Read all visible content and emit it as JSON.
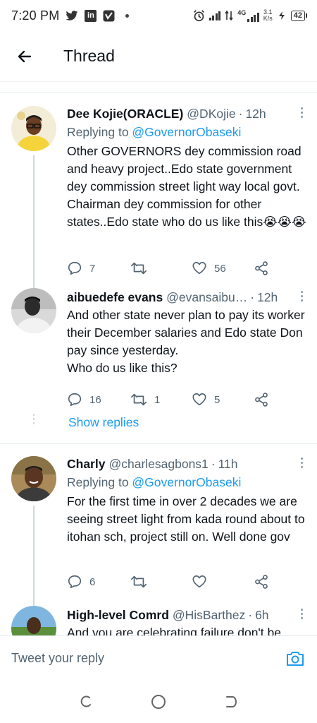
{
  "status_bar": {
    "time": "7:20 PM",
    "apps": [
      "twitter-icon",
      "linkedin-icon",
      "vimeo-icon"
    ],
    "network": "4G",
    "speed_value": "3.1",
    "speed_unit": "K/s",
    "battery": "42"
  },
  "header": {
    "title": "Thread"
  },
  "tweets": [
    {
      "name": "Dee Kojie(ORACLE)",
      "handle": "@DKojie",
      "time": "12h",
      "replying_prefix": "Replying to ",
      "replying_to": "@GovernorObaseki",
      "text": "Other GOVERNORS dey commission road and heavy project..Edo state government dey commission street light way local govt. Chairman dey commission for other states..Edo state who do us like this😭😭😭",
      "replies": "7",
      "retweets": "",
      "likes": "56"
    },
    {
      "name": "aibuedefe evans",
      "handle": "@evansaibu…",
      "time": "12h",
      "text": "And other state never plan to pay its worker their December salaries and Edo state Don pay since yesterday.\nWho do us like this?",
      "replies": "16",
      "retweets": "1",
      "likes": "5"
    },
    {
      "name": "Charly",
      "handle": "@charlesagbons1",
      "time": "11h",
      "replying_prefix": "Replying to ",
      "replying_to": "@GovernorObaseki",
      "text": "For the first time in over 2 decades we are seeing street light from kada round about to itohan sch, project still on. Well done gov",
      "replies": "6",
      "retweets": "",
      "likes": ""
    },
    {
      "name": "High-level Comrd",
      "handle": "@HisBarthez",
      "time": "6h",
      "text": "And you are celebrating failure don't be"
    }
  ],
  "show_replies_label": "Show replies",
  "reply_bar": {
    "placeholder": "Tweet your reply"
  },
  "colors": {
    "accent": "#1d9bf0",
    "secondary_text": "#536471",
    "primary_text": "#0f1419",
    "divider": "#e6ecf0"
  }
}
